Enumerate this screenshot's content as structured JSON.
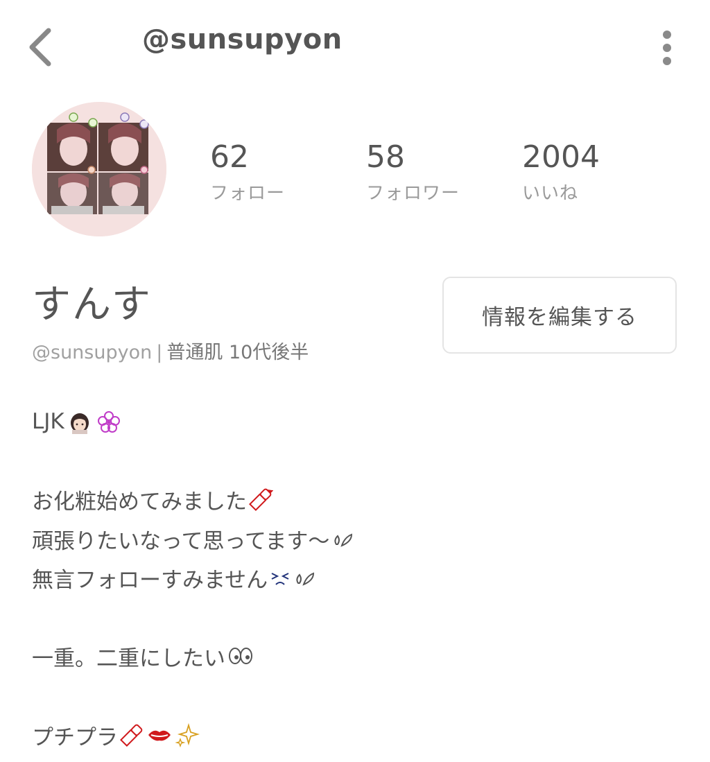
{
  "header": {
    "title": "@sunsupyon",
    "back_icon": "chevron-left-icon",
    "more_icon": "more-vertical-icon"
  },
  "profile": {
    "avatar_icon": "avatar-photo",
    "display_name": "すんす",
    "handle": "@sunsupyon",
    "separator": "|",
    "skin_type": "普通肌",
    "age": "10代後半",
    "edit_button": "情報を編集する"
  },
  "stats": [
    {
      "value": "62",
      "label": "フォロー"
    },
    {
      "value": "58",
      "label": "フォロワー"
    },
    {
      "value": "2004",
      "label": "いいね"
    }
  ],
  "bio": {
    "line1": "LJK",
    "line2": "お化粧始めてみました",
    "line3": "頑張りたいなって思ってます〜",
    "line4": "無言フォローすみません",
    "line5": "一重。二重にしたい",
    "line6": "プチプラ"
  },
  "colors": {
    "text": "#555555",
    "muted": "#9a9a9a",
    "avatar_bg": "#f5e1e0",
    "border": "#e4e4e4",
    "emoji_red": "#d0191c",
    "emoji_pink": "#c03cc8"
  }
}
